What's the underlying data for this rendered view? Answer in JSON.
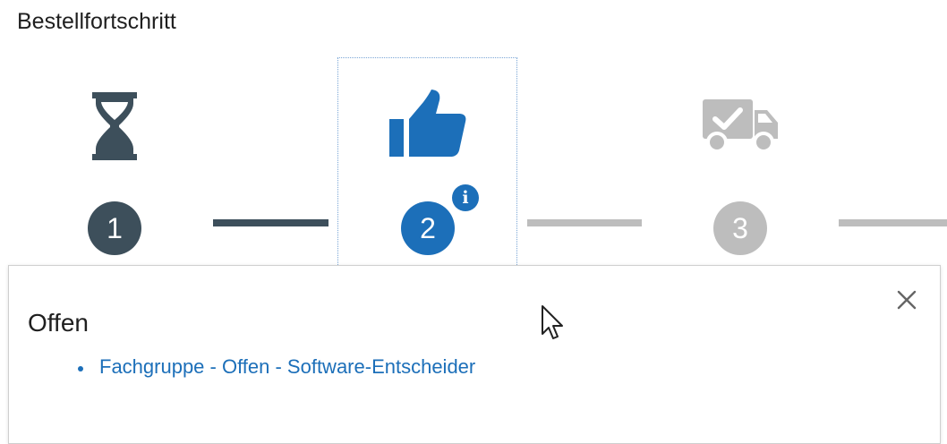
{
  "header": {
    "title": "Bestellfortschritt"
  },
  "steps": [
    {
      "number": "1",
      "icon": "hourglass-icon",
      "state": "completed",
      "color": "#3d4f5b"
    },
    {
      "number": "2",
      "icon": "thumbs-up-icon",
      "state": "current",
      "color": "#1c6fb9",
      "has_info": true
    },
    {
      "number": "3",
      "icon": "delivery-truck-check-icon",
      "state": "pending",
      "color": "#bdbdbd"
    }
  ],
  "info_badge": {
    "label": "i"
  },
  "popover": {
    "title": "Offen",
    "items": [
      {
        "label": "Fachgruppe - Offen - Software-Entscheider"
      }
    ],
    "close_icon": "close-icon"
  },
  "colors": {
    "completed": "#3d4f5b",
    "active": "#1c6fb9",
    "pending": "#bdbdbd",
    "link": "#1c6fb9"
  }
}
